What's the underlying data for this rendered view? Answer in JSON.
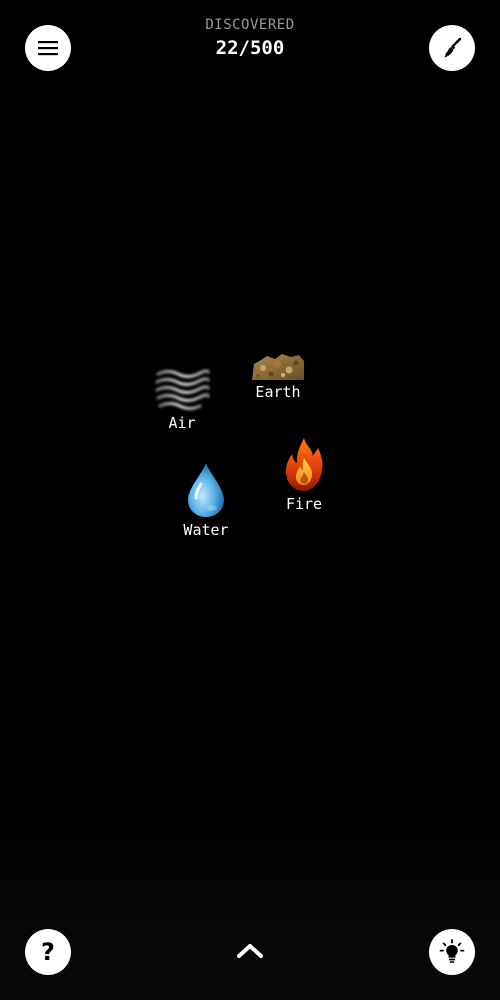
{
  "header": {
    "discovered_label": "DISCOVERED",
    "discovered_count": "22/500"
  },
  "toolbar": {
    "menu_icon": "hamburger-menu-icon",
    "clear_icon": "broom-icon",
    "help_label": "?",
    "help_icon": "question-mark-icon",
    "hint_icon": "lightbulb-icon",
    "expand_icon": "chevron-up-icon"
  },
  "elements": [
    {
      "name": "Air",
      "icon": "air-wind-icon"
    },
    {
      "name": "Earth",
      "icon": "earth-soil-icon"
    },
    {
      "name": "Fire",
      "icon": "fire-flame-icon"
    },
    {
      "name": "Water",
      "icon": "water-drop-icon"
    }
  ],
  "colors": {
    "background": "#000000",
    "button": "#ffffff",
    "label_muted": "#9a9a9a",
    "text": "#ffffff"
  }
}
